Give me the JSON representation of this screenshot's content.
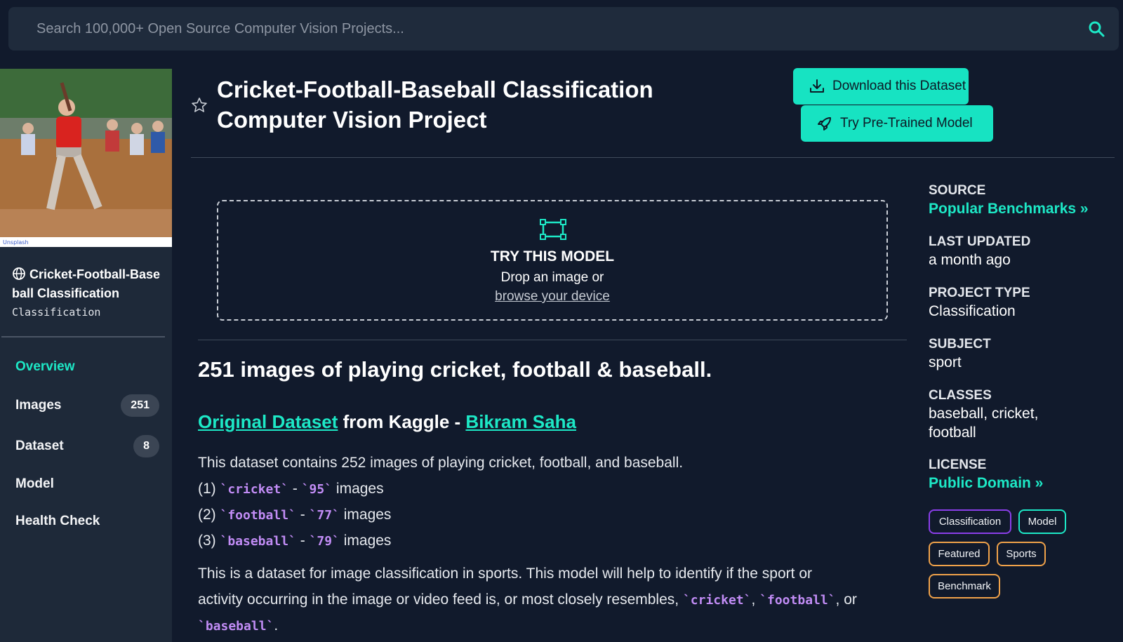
{
  "search": {
    "placeholder": "Search 100,000+ Open Source Computer Vision Projects..."
  },
  "sidebar": {
    "project_name": "Cricket-Football-Baseball Classification",
    "project_type": "Classification",
    "thumbnail_credit": "Unsplash",
    "nav": [
      {
        "label": "Overview",
        "active": true
      },
      {
        "label": "Images",
        "count": "251"
      },
      {
        "label": "Dataset",
        "count": "8"
      },
      {
        "label": "Model"
      },
      {
        "label": "Health Check"
      }
    ]
  },
  "header": {
    "title": "Cricket-Football-Baseball Classification Computer Vision Project",
    "download_label": "Download this Dataset",
    "try_label": "Try Pre-Trained Model"
  },
  "try_box": {
    "title": "TRY THIS MODEL",
    "subtitle": "Drop an image or",
    "browse_link": "browse your device"
  },
  "content": {
    "headline": "251 images of playing cricket, football & baseball.",
    "source_link": "Original Dataset",
    "source_mid": " from Kaggle - ",
    "author_link": "Bikram Saha",
    "intro": "This dataset contains 252 images of playing cricket, football, and baseball.",
    "items": [
      {
        "prefix": "(1) ",
        "class": "`cricket`",
        "sep": " - ",
        "count": "`95`",
        "suffix": " images"
      },
      {
        "prefix": "(2) ",
        "class": "`football`",
        "sep": " - ",
        "count": "`77`",
        "suffix": " images"
      },
      {
        "prefix": "(3) ",
        "class": "`baseball`",
        "sep": " - ",
        "count": "`79`",
        "suffix": " images"
      }
    ],
    "desc_1": "This is a dataset for image classification in sports. This model will help to identify if the sport or",
    "desc_2": "activity occurring in the image or video feed is, or most closely resembles, ",
    "desc_code_1": "`cricket`",
    "desc_comma_1": ", ",
    "desc_code_2": "`football`",
    "desc_or": ", or",
    "desc_code_3": "`baseball`",
    "desc_end": "."
  },
  "meta": {
    "source_label": "SOURCE",
    "source_value": "Popular Benchmarks »",
    "updated_label": "LAST UPDATED",
    "updated_value": "a month ago",
    "type_label": "PROJECT TYPE",
    "type_value": "Classification",
    "subject_label": "SUBJECT",
    "subject_value": "sport",
    "classes_label": "CLASSES",
    "classes_value_1": "baseball, cricket,",
    "classes_value_2": "football",
    "license_label": "LICENSE",
    "license_value": "Public Domain »"
  },
  "tags": [
    "Classification",
    "Model",
    "Featured",
    "Sports",
    "Benchmark"
  ],
  "colors": {
    "accent": "#1de8c6",
    "background": "#111a2c",
    "sidebar": "#1e2939",
    "code": "#c18cf5",
    "tag_purple": "#8a3ee8",
    "tag_orange": "#f0a24a"
  }
}
